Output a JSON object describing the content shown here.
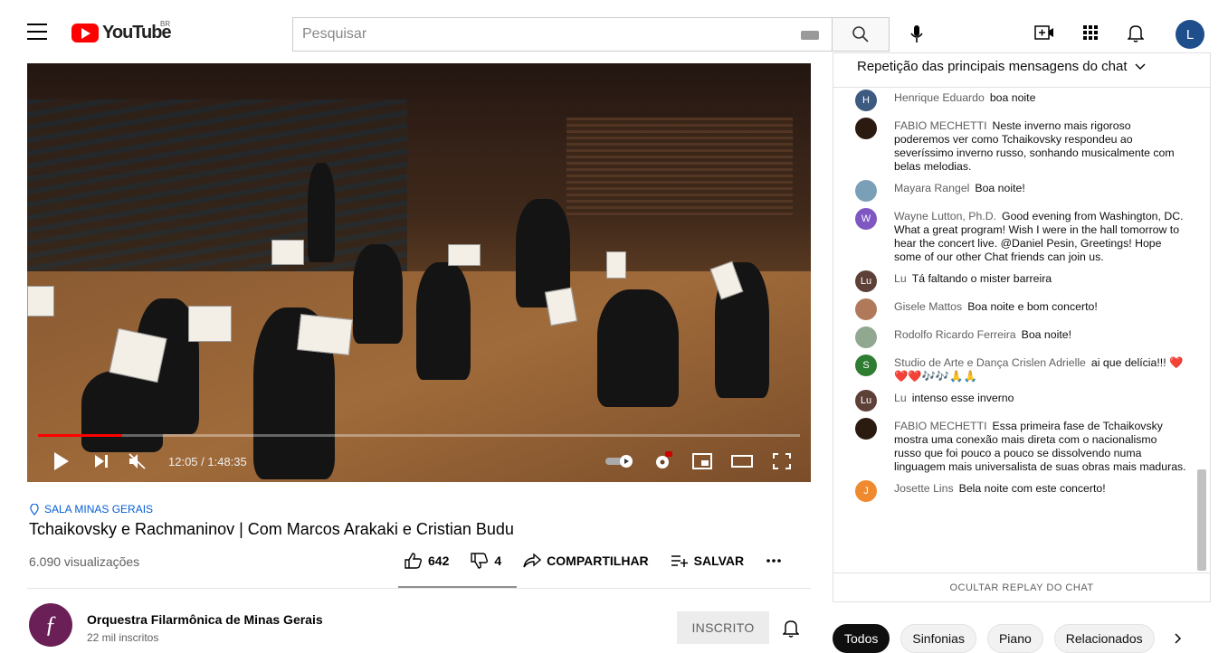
{
  "header": {
    "logo_text": "YouTube",
    "country_code": "BR",
    "search_placeholder": "Pesquisar",
    "avatar_letter": "L"
  },
  "player": {
    "time": "12:05 / 1:48:35",
    "progress_fraction": 0.111
  },
  "video": {
    "location": "SALA MINAS GERAIS",
    "title": "Tchaikovsky e Rachmaninov | Com Marcos Arakaki e Cristian Budu",
    "views": "6.090 visualizações",
    "likes": "642",
    "dislikes": "4",
    "share_label": "COMPARTILHAR",
    "save_label": "SALVAR"
  },
  "channel": {
    "name": "Orquestra Filarmônica de Minas Gerais",
    "subscribers": "22 mil inscritos",
    "subscribed_label": "INSCRITO"
  },
  "chat": {
    "header": "Repetição das principais mensagens do chat",
    "footer": "OCULTAR REPLAY DO CHAT",
    "messages": [
      {
        "author": "Henrique Eduardo",
        "text": "boa noite",
        "initial": "H",
        "color": "#3d5a80"
      },
      {
        "author": "FABIO MECHETTI",
        "text": "Neste inverno mais rigoroso poderemos ver como Tchaikovsky respondeu ao severíssimo inverno russo, sonhando musicalmente com belas melodias.",
        "initial": "",
        "color": "#2b1a10"
      },
      {
        "author": "Mayara Rangel",
        "text": "Boa noite!",
        "initial": "",
        "color": "#7aa0b8"
      },
      {
        "author": "Wayne Lutton, Ph.D.",
        "text": "Good evening from Washington, DC. What a great program! Wish I were in the hall tomorrow to hear the concert live. @Daniel Pesin, Greetings! Hope some of our other Chat friends can join us.",
        "initial": "W",
        "color": "#7e57c2"
      },
      {
        "author": "Lu",
        "text": "Tá faltando o mister barreira",
        "initial": "Lu",
        "color": "#5d4037"
      },
      {
        "author": "Gisele Mattos",
        "text": "Boa noite e bom concerto!",
        "initial": "",
        "color": "#b07a5a"
      },
      {
        "author": "Rodolfo Ricardo Ferreira",
        "text": "Boa noite!",
        "initial": "",
        "color": "#8fa88f"
      },
      {
        "author": "Studio de Arte e Dança Crislen Adrielle",
        "text": "ai que delícia!!! ❤️❤️❤️🎶🎶🙏🙏",
        "initial": "S",
        "color": "#2e7d32"
      },
      {
        "author": "Lu",
        "text": "intenso esse inverno",
        "initial": "Lu",
        "color": "#5d4037"
      },
      {
        "author": "FABIO MECHETTI",
        "text": "Essa primeira fase de Tchaikovsky mostra uma conexão mais direta com o nacionalismo russo que foi pouco a pouco se dissolvendo numa linguagem mais universalista de suas obras mais maduras.",
        "initial": "",
        "color": "#2b1a10"
      },
      {
        "author": "Josette Lins",
        "text": "Bela noite com este concerto!",
        "initial": "J",
        "color": "#ef8a2f"
      }
    ]
  },
  "chips": [
    "Todos",
    "Sinfonias",
    "Piano",
    "Relacionados"
  ]
}
